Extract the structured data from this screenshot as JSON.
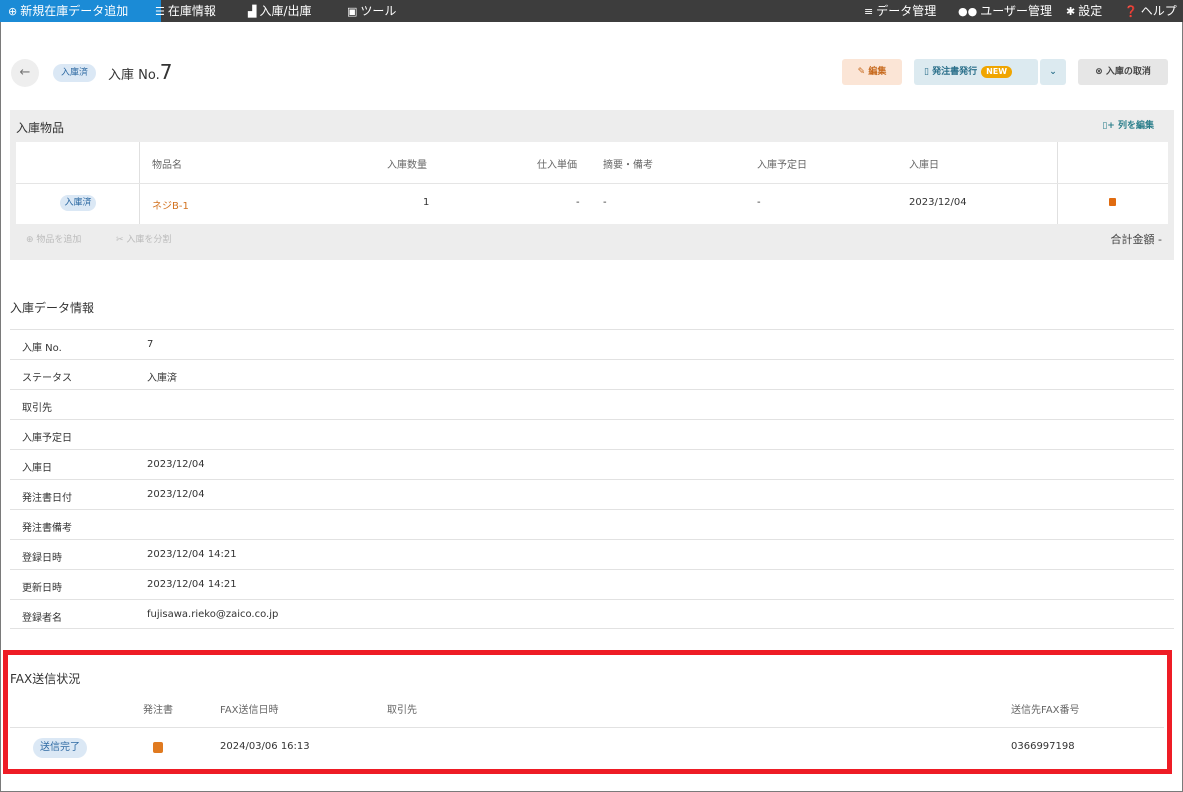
{
  "topbar": {
    "add_label": "新規在庫データ追加",
    "stock_label": "在庫情報",
    "io_label": "入庫/出庫",
    "tools_label": "ツール",
    "data_label": "データ管理",
    "users_label": "ユーザー管理",
    "settings_label": "設定",
    "help_label": "ヘルプ"
  },
  "header": {
    "status_badge": "入庫済",
    "title_prefix": "入庫 No.",
    "number": "7",
    "edit_label": "編集",
    "po_label": "発注書発行",
    "new_badge": "NEW",
    "cancel_label": "入庫の取消"
  },
  "items_panel": {
    "title": "入庫物品",
    "edit_cols": "列を編集",
    "columns": [
      "物品名",
      "入庫数量",
      "仕入単価",
      "摘要・備考",
      "入庫予定日",
      "入庫日"
    ],
    "row": {
      "badge": "入庫済",
      "name": "ネジB-1",
      "qty": "1",
      "price": "-",
      "note": "-",
      "planned": "-",
      "date": "2023/12/04"
    },
    "add_item": "物品を追加",
    "split": "入庫を分割",
    "total_label": "合計金額",
    "total_value": "-"
  },
  "info": {
    "title": "入庫データ情報",
    "rows": [
      {
        "key": "入庫 No.",
        "value": "7"
      },
      {
        "key": "ステータス",
        "value": "入庫済"
      },
      {
        "key": "取引先",
        "value": ""
      },
      {
        "key": "入庫予定日",
        "value": ""
      },
      {
        "key": "入庫日",
        "value": "2023/12/04"
      },
      {
        "key": "発注書日付",
        "value": "2023/12/04"
      },
      {
        "key": "発注書備考",
        "value": ""
      },
      {
        "key": "登録日時",
        "value": "2023/12/04 14:21"
      },
      {
        "key": "更新日時",
        "value": "2023/12/04 14:21"
      },
      {
        "key": "登録者名",
        "value": "fujisawa.rieko@zaico.co.jp"
      }
    ]
  },
  "fax": {
    "title": "FAX送信状況",
    "columns": [
      "発注書",
      "FAX送信日時",
      "取引先",
      "送信先FAX番号"
    ],
    "row": {
      "status": "送信完了",
      "sent_at": "2024/03/06 16:13",
      "partner": "",
      "fax_number": "0366997198"
    }
  },
  "colors": {
    "topbar": "#3d3d3d",
    "primary": "#1b8bd6",
    "highlight": "#ee1c25",
    "accent_orange": "#e06b10"
  }
}
